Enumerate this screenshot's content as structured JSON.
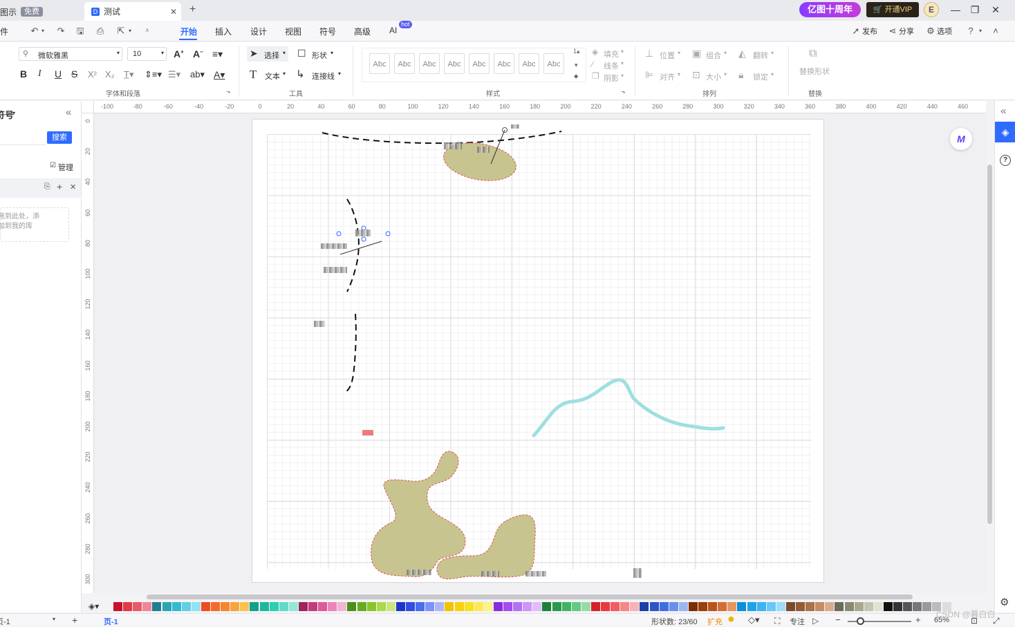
{
  "titlebar": {
    "left_tab_label": "图示",
    "free_badge": "免费",
    "active_tab_label": "测试",
    "anniversary": "亿图十周年",
    "vip_label": "开通VIP",
    "avatar_letter": "E"
  },
  "menubar": {
    "file_label": "件",
    "tabs": [
      {
        "label": "开始"
      },
      {
        "label": "插入"
      },
      {
        "label": "设计"
      },
      {
        "label": "视图"
      },
      {
        "label": "符号"
      },
      {
        "label": "高级"
      },
      {
        "label": "AI"
      }
    ],
    "hot_badge": "hot",
    "publish": "发布",
    "share": "分享",
    "options": "选项"
  },
  "ribbon": {
    "font_family": "微软雅黑",
    "font_size": "10",
    "select": "选择",
    "shape": "形状",
    "text": "文本",
    "connector": "连接线",
    "style_sample": "Abc",
    "fill": "填充",
    "line": "线条",
    "shadow": "阴影",
    "position": "位置",
    "group": "组合",
    "flip": "翻转",
    "align": "对齐",
    "size": "大小",
    "lock": "锁定",
    "replace_shape": "替换形状",
    "group_labels": {
      "font": "字体和段落",
      "tools": "工具",
      "style": "样式",
      "arrange": "排列",
      "replace": "替换"
    }
  },
  "leftpanel": {
    "title": "符号",
    "search_button": "搜索",
    "manage": "管理",
    "drop_hint_line1": "拖到此处，添",
    "drop_hint_line2": "加到我的库"
  },
  "ruler": {
    "h_labels": [
      "-100",
      "-80",
      "-60",
      "-40",
      "-20",
      "0",
      "20",
      "40",
      "60",
      "80",
      "100",
      "120",
      "140",
      "160",
      "180",
      "200",
      "220",
      "240",
      "260",
      "280",
      "300",
      "320",
      "340",
      "360",
      "380",
      "400",
      "420",
      "440",
      "460"
    ],
    "v_labels": [
      "0",
      "20",
      "40",
      "60",
      "80",
      "100",
      "120",
      "140",
      "160",
      "180",
      "200",
      "220",
      "240",
      "260",
      "280",
      "300"
    ]
  },
  "statusbar": {
    "page_selector": "页-1",
    "page_tab": "页-1",
    "shape_count": "形状数: 23/60",
    "expand": "扩充",
    "focus": "专注",
    "zoom": "65%",
    "watermark": "CSDN @暮白白"
  },
  "colors": {
    "accent": "#2f6bff",
    "shape_fill": "#c8c48f",
    "shape_border": "#e05050",
    "river": "#9fdfe0"
  },
  "palette": [
    "#c8102e",
    "#e03a4a",
    "#e8596b",
    "#f08796",
    "#1f7f8f",
    "#2aa5b5",
    "#35b9d0",
    "#5fd0e8",
    "#8fe3f2",
    "#f04b1e",
    "#f26b2a",
    "#f5852f",
    "#f8a43a",
    "#f9c24f",
    "#12a08a",
    "#1cb89e",
    "#2ecdb0",
    "#5fdcc4",
    "#93e8d6",
    "#a0245e",
    "#c43b7c",
    "#df5a9a",
    "#ec86b6",
    "#f3b3d1",
    "#4a8f1a",
    "#6aaa22",
    "#8ac42c",
    "#acd84c",
    "#c9e77e",
    "#1f36c8",
    "#2f4fe0",
    "#4a6ef0",
    "#7d93f5",
    "#aab8f8",
    "#f2c400",
    "#f5d20a",
    "#f8e01e",
    "#fbea52",
    "#fcf38a",
    "#8a2be2",
    "#a24ef0",
    "#b86ff5",
    "#cc95f8",
    "#dfbcfb",
    "#1e7f3c",
    "#2b9a4c",
    "#3fb462",
    "#66c884",
    "#96dcaa",
    "#d8202a",
    "#e8393f",
    "#f25b5f",
    "#f68789",
    "#f9b2b3",
    "#1a3fa8",
    "#2b55c8",
    "#3f6ee0",
    "#6a90ea",
    "#9cb6f2",
    "#7a2e00",
    "#9a3e0a",
    "#b8551a",
    "#d26f32",
    "#e8955e",
    "#0a8fd8",
    "#1ea2e8",
    "#3ab4f2",
    "#68c8f6",
    "#9cdcfa",
    "#7a4a2a",
    "#935c36",
    "#ab7148",
    "#c38c66",
    "#d9ab8c",
    "#6b6b5a",
    "#8a8a72",
    "#a8a88e",
    "#c6c6ae",
    "#e2e2d2",
    "#111111",
    "#333333",
    "#555555",
    "#777777",
    "#999999",
    "#bbbbbb",
    "#dddddd",
    "#f3f3f3"
  ]
}
